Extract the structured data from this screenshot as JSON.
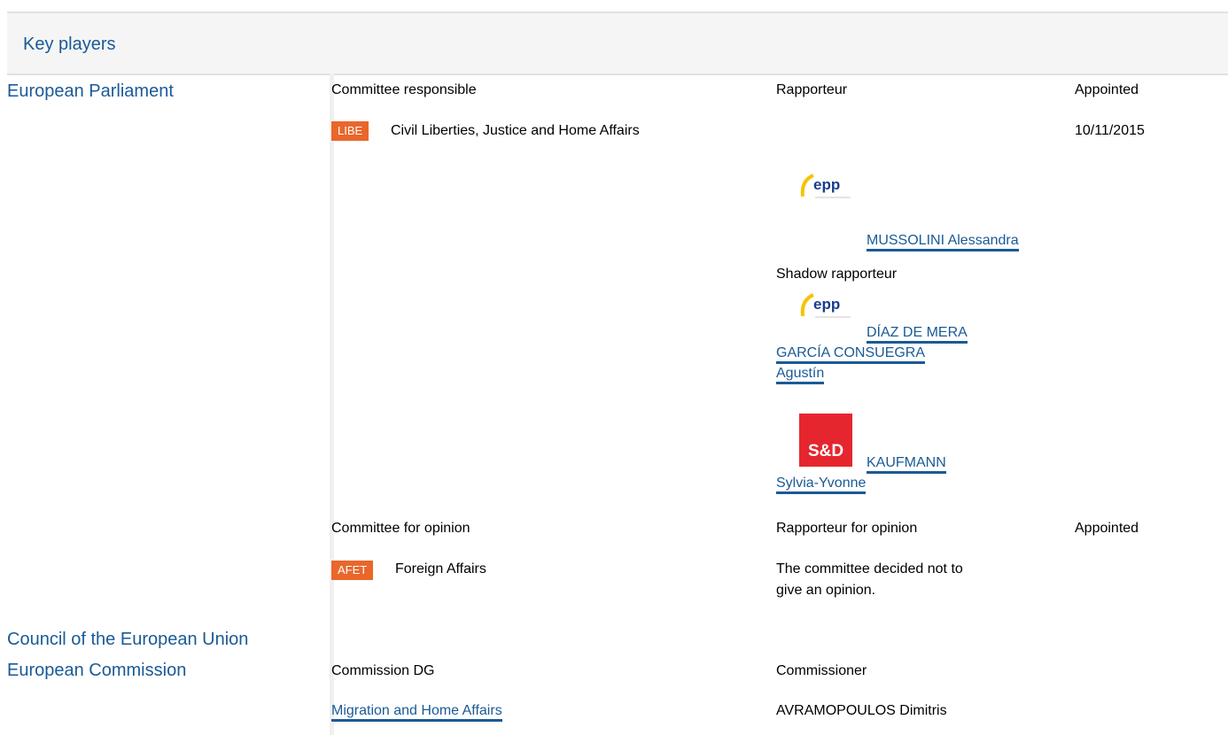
{
  "header": {
    "title": "Key players"
  },
  "institutions": {
    "ep": "European Parliament",
    "council": "Council of the European Union",
    "commission": "European Commission"
  },
  "ep": {
    "committee_responsible_label": "Committee responsible",
    "rapporteur_label": "Rapporteur",
    "appointed_label": "Appointed",
    "responsible_committee": {
      "code": "LIBE",
      "name": "Civil Liberties, Justice and Home Affairs",
      "appointed": "10/11/2015"
    },
    "rapporteur": {
      "group_logo": "epp-logo",
      "name": "MUSSOLINI Alessandra"
    },
    "shadow_label": "Shadow rapporteur",
    "shadow_rapporteurs": [
      {
        "group_logo": "epp-logo",
        "name_lines": [
          "DÍAZ DE MERA",
          "GARCÍA CONSUEGRA",
          "Agustín"
        ]
      },
      {
        "group_logo": "sd-logo",
        "logo_text": "S&D",
        "name_lines": [
          "KAUFMANN",
          "Sylvia-Yvonne"
        ]
      }
    ],
    "committee_opinion_label": "Committee for opinion",
    "rapporteur_opinion_label": "Rapporteur for opinion",
    "appointed_opinion_label": "Appointed",
    "opinion_committee": {
      "code": "AFET",
      "name": "Foreign Affairs"
    },
    "opinion_note_lines": [
      "The committee decided not to",
      "give an opinion."
    ]
  },
  "commission": {
    "dg_label": "Commission DG",
    "commissioner_label": "Commissioner",
    "dg": "Migration and Home Affairs",
    "commissioner": "AVRAMOPOULOS Dimitris"
  },
  "colors": {
    "link": "#1a5a96",
    "badge": "#e9672b",
    "sd_red": "#e5262e",
    "epp_yellow": "#f5c400"
  }
}
